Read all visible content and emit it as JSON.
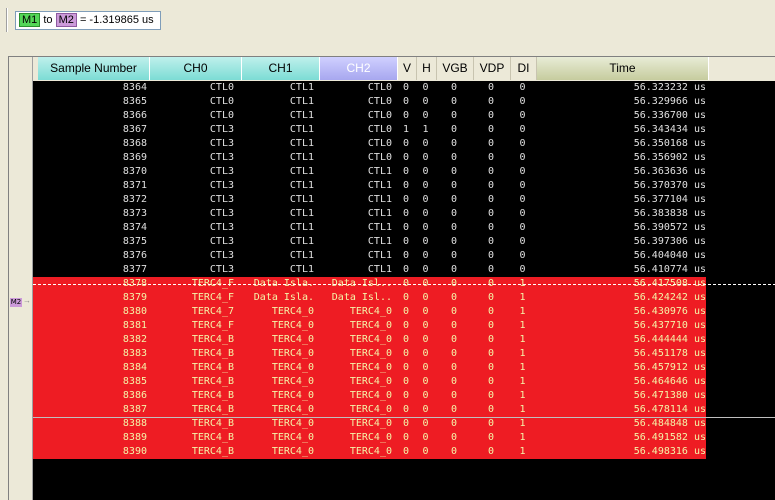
{
  "measurement": {
    "m1": "M1",
    "to": "to",
    "m2": "M2",
    "equals": "= -1.319865 us"
  },
  "columns": [
    "Sample Number",
    "CH0",
    "CH1",
    "CH2",
    "V",
    "H",
    "VGB",
    "VDP",
    "DI",
    "Time"
  ],
  "marker_gutter": {
    "m2_label": "M2",
    "arrow": "→"
  },
  "colors": {
    "black_row": "#000000",
    "red_row": "#ee1c23",
    "red_text": "#f4f4a8",
    "selected_header": "#a7a7ef"
  },
  "rows": [
    {
      "sample": "8364",
      "ch0": "CTL0",
      "ch1": "CTL1",
      "ch2": "CTL0",
      "v": "0",
      "h": "0",
      "vgb": "0",
      "vdp": "0",
      "di": "0",
      "time": "56.323232 us",
      "style": "black"
    },
    {
      "sample": "8365",
      "ch0": "CTL0",
      "ch1": "CTL1",
      "ch2": "CTL0",
      "v": "0",
      "h": "0",
      "vgb": "0",
      "vdp": "0",
      "di": "0",
      "time": "56.329966 us",
      "style": "black"
    },
    {
      "sample": "8366",
      "ch0": "CTL0",
      "ch1": "CTL1",
      "ch2": "CTL0",
      "v": "0",
      "h": "0",
      "vgb": "0",
      "vdp": "0",
      "di": "0",
      "time": "56.336700 us",
      "style": "black"
    },
    {
      "sample": "8367",
      "ch0": "CTL3",
      "ch1": "CTL1",
      "ch2": "CTL0",
      "v": "1",
      "h": "1",
      "vgb": "0",
      "vdp": "0",
      "di": "0",
      "time": "56.343434 us",
      "style": "black"
    },
    {
      "sample": "8368",
      "ch0": "CTL3",
      "ch1": "CTL1",
      "ch2": "CTL0",
      "v": "0",
      "h": "0",
      "vgb": "0",
      "vdp": "0",
      "di": "0",
      "time": "56.350168 us",
      "style": "black"
    },
    {
      "sample": "8369",
      "ch0": "CTL3",
      "ch1": "CTL1",
      "ch2": "CTL0",
      "v": "0",
      "h": "0",
      "vgb": "0",
      "vdp": "0",
      "di": "0",
      "time": "56.356902 us",
      "style": "black"
    },
    {
      "sample": "8370",
      "ch0": "CTL3",
      "ch1": "CTL1",
      "ch2": "CTL1",
      "v": "0",
      "h": "0",
      "vgb": "0",
      "vdp": "0",
      "di": "0",
      "time": "56.363636 us",
      "style": "black"
    },
    {
      "sample": "8371",
      "ch0": "CTL3",
      "ch1": "CTL1",
      "ch2": "CTL1",
      "v": "0",
      "h": "0",
      "vgb": "0",
      "vdp": "0",
      "di": "0",
      "time": "56.370370 us",
      "style": "black"
    },
    {
      "sample": "8372",
      "ch0": "CTL3",
      "ch1": "CTL1",
      "ch2": "CTL1",
      "v": "0",
      "h": "0",
      "vgb": "0",
      "vdp": "0",
      "di": "0",
      "time": "56.377104 us",
      "style": "black"
    },
    {
      "sample": "8373",
      "ch0": "CTL3",
      "ch1": "CTL1",
      "ch2": "CTL1",
      "v": "0",
      "h": "0",
      "vgb": "0",
      "vdp": "0",
      "di": "0",
      "time": "56.383838 us",
      "style": "black"
    },
    {
      "sample": "8374",
      "ch0": "CTL3",
      "ch1": "CTL1",
      "ch2": "CTL1",
      "v": "0",
      "h": "0",
      "vgb": "0",
      "vdp": "0",
      "di": "0",
      "time": "56.390572 us",
      "style": "black"
    },
    {
      "sample": "8375",
      "ch0": "CTL3",
      "ch1": "CTL1",
      "ch2": "CTL1",
      "v": "0",
      "h": "0",
      "vgb": "0",
      "vdp": "0",
      "di": "0",
      "time": "56.397306 us",
      "style": "black"
    },
    {
      "sample": "8376",
      "ch0": "CTL3",
      "ch1": "CTL1",
      "ch2": "CTL1",
      "v": "0",
      "h": "0",
      "vgb": "0",
      "vdp": "0",
      "di": "0",
      "time": "56.404040 us",
      "style": "black"
    },
    {
      "sample": "8377",
      "ch0": "CTL3",
      "ch1": "CTL1",
      "ch2": "CTL1",
      "v": "0",
      "h": "0",
      "vgb": "0",
      "vdp": "0",
      "di": "0",
      "time": "56.410774 us",
      "style": "black"
    },
    {
      "sample": "8378",
      "ch0": "TERC4_F",
      "ch1": "Data Isla.",
      "ch2": "Data Isl..",
      "v": "0",
      "h": "0",
      "vgb": "0",
      "vdp": "0",
      "di": "1",
      "time": "56.417508 us",
      "style": "red"
    },
    {
      "sample": "8379",
      "ch0": "TERC4_F",
      "ch1": "Data Isla.",
      "ch2": "Data Isl..",
      "v": "0",
      "h": "0",
      "vgb": "0",
      "vdp": "0",
      "di": "1",
      "time": "56.424242 us",
      "style": "red"
    },
    {
      "sample": "8380",
      "ch0": "TERC4_7",
      "ch1": "TERC4_0",
      "ch2": "TERC4_0",
      "v": "0",
      "h": "0",
      "vgb": "0",
      "vdp": "0",
      "di": "1",
      "time": "56.430976 us",
      "style": "red"
    },
    {
      "sample": "8381",
      "ch0": "TERC4_F",
      "ch1": "TERC4_0",
      "ch2": "TERC4_0",
      "v": "0",
      "h": "0",
      "vgb": "0",
      "vdp": "0",
      "di": "1",
      "time": "56.437710 us",
      "style": "red"
    },
    {
      "sample": "8382",
      "ch0": "TERC4_B",
      "ch1": "TERC4_0",
      "ch2": "TERC4_0",
      "v": "0",
      "h": "0",
      "vgb": "0",
      "vdp": "0",
      "di": "1",
      "time": "56.444444 us",
      "style": "red"
    },
    {
      "sample": "8383",
      "ch0": "TERC4_B",
      "ch1": "TERC4_0",
      "ch2": "TERC4_0",
      "v": "0",
      "h": "0",
      "vgb": "0",
      "vdp": "0",
      "di": "1",
      "time": "56.451178 us",
      "style": "red"
    },
    {
      "sample": "8384",
      "ch0": "TERC4_B",
      "ch1": "TERC4_0",
      "ch2": "TERC4_0",
      "v": "0",
      "h": "0",
      "vgb": "0",
      "vdp": "0",
      "di": "1",
      "time": "56.457912 us",
      "style": "red"
    },
    {
      "sample": "8385",
      "ch0": "TERC4_B",
      "ch1": "TERC4_0",
      "ch2": "TERC4_0",
      "v": "0",
      "h": "0",
      "vgb": "0",
      "vdp": "0",
      "di": "1",
      "time": "56.464646 us",
      "style": "red"
    },
    {
      "sample": "8386",
      "ch0": "TERC4_B",
      "ch1": "TERC4_0",
      "ch2": "TERC4_0",
      "v": "0",
      "h": "0",
      "vgb": "0",
      "vdp": "0",
      "di": "1",
      "time": "56.471380 us",
      "style": "red"
    },
    {
      "sample": "8387",
      "ch0": "TERC4_B",
      "ch1": "TERC4_0",
      "ch2": "TERC4_0",
      "v": "0",
      "h": "0",
      "vgb": "0",
      "vdp": "0",
      "di": "1",
      "time": "56.478114 us",
      "style": "red"
    },
    {
      "sample": "8388",
      "ch0": "TERC4_B",
      "ch1": "TERC4_0",
      "ch2": "TERC4_0",
      "v": "0",
      "h": "0",
      "vgb": "0",
      "vdp": "0",
      "di": "1",
      "time": "56.484848 us",
      "style": "red"
    },
    {
      "sample": "8389",
      "ch0": "TERC4_B",
      "ch1": "TERC4_0",
      "ch2": "TERC4_0",
      "v": "0",
      "h": "0",
      "vgb": "0",
      "vdp": "0",
      "di": "1",
      "time": "56.491582 us",
      "style": "red"
    },
    {
      "sample": "8390",
      "ch0": "TERC4_B",
      "ch1": "TERC4_0",
      "ch2": "TERC4_0",
      "v": "0",
      "h": "0",
      "vgb": "0",
      "vdp": "0",
      "di": "1",
      "time": "56.498316 us",
      "style": "red"
    }
  ]
}
